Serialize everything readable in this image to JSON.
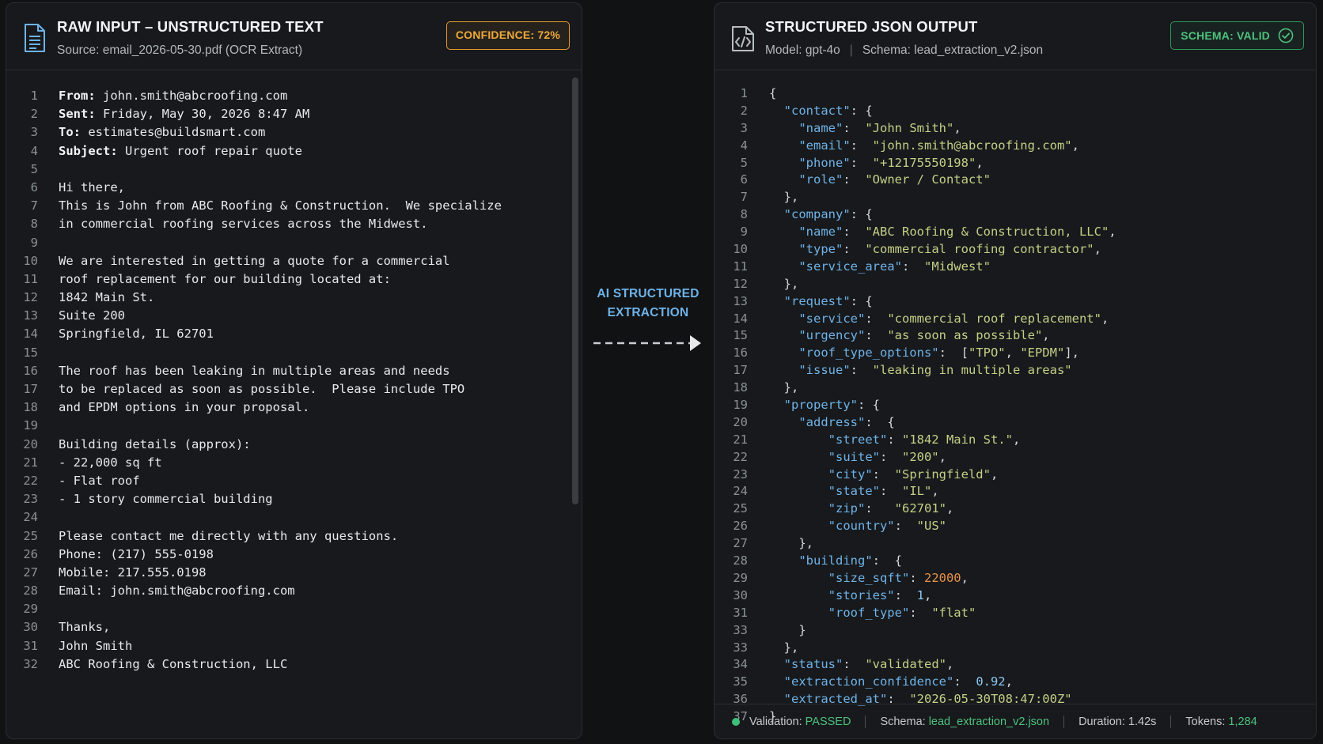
{
  "left_panel": {
    "title": "RAW INPUT – UNSTRUCTURED TEXT",
    "source": "Source: email_2026-05-30.pdf (OCR Extract)",
    "confidence_badge": "CONFIDENCE: 72%",
    "icon": "document-icon",
    "lines": [
      {
        "n": "1",
        "label": "From:",
        "text": " john.smith@abcroofing.com"
      },
      {
        "n": "2",
        "label": "Sent:",
        "text": " Friday, May 30, 2026 8:47 AM"
      },
      {
        "n": "3",
        "label": "To:",
        "text": " estimates@buildsmart.com"
      },
      {
        "n": "4",
        "label": "Subject:",
        "text": " Urgent roof repair quote"
      },
      {
        "n": "5",
        "label": "",
        "text": ""
      },
      {
        "n": "6",
        "label": "",
        "text": "Hi there,"
      },
      {
        "n": "7",
        "label": "",
        "text": "This is John from ABC Roofing & Construction.  We specialize"
      },
      {
        "n": "8",
        "label": "",
        "text": "in commercial roofing services across the Midwest."
      },
      {
        "n": "9",
        "label": "",
        "text": ""
      },
      {
        "n": "10",
        "label": "",
        "text": "We are interested in getting a quote for a commercial"
      },
      {
        "n": "11",
        "label": "",
        "text": "roof replacement for our building located at:"
      },
      {
        "n": "12",
        "label": "",
        "text": "1842 Main St."
      },
      {
        "n": "13",
        "label": "",
        "text": "Suite 200"
      },
      {
        "n": "14",
        "label": "",
        "text": "Springfield, IL 62701"
      },
      {
        "n": "15",
        "label": "",
        "text": ""
      },
      {
        "n": "16",
        "label": "",
        "text": "The roof has been leaking in multiple areas and needs"
      },
      {
        "n": "17",
        "label": "",
        "text": "to be replaced as soon as possible.  Please include TPO"
      },
      {
        "n": "18",
        "label": "",
        "text": "and EPDM options in your proposal."
      },
      {
        "n": "19",
        "label": "",
        "text": ""
      },
      {
        "n": "20",
        "label": "",
        "text": "Building details (approx):"
      },
      {
        "n": "21",
        "label": "",
        "text": "- 22,000 sq ft"
      },
      {
        "n": "22",
        "label": "",
        "text": "- Flat roof"
      },
      {
        "n": "23",
        "label": "",
        "text": "- 1 story commercial building"
      },
      {
        "n": "24",
        "label": "",
        "text": ""
      },
      {
        "n": "25",
        "label": "",
        "text": "Please contact me directly with any questions."
      },
      {
        "n": "26",
        "label": "",
        "text": "Phone: (217) 555-0198"
      },
      {
        "n": "27",
        "label": "",
        "text": "Mobile: 217.555.0198"
      },
      {
        "n": "28",
        "label": "",
        "text": "Email: john.smith@abcroofing.com"
      },
      {
        "n": "29",
        "label": "",
        "text": ""
      },
      {
        "n": "30",
        "label": "",
        "text": "Thanks,"
      },
      {
        "n": "31",
        "label": "",
        "text": "John Smith"
      },
      {
        "n": "32",
        "label": "",
        "text": "ABC Roofing & Construction, LLC"
      }
    ]
  },
  "middle": {
    "label_line1": "AI STRUCTURED",
    "label_line2": "EXTRACTION",
    "arrow_icon": "dashed-arrow-right-icon"
  },
  "right_panel": {
    "title": "STRUCTURED JSON OUTPUT",
    "model": "Model: gpt-4o",
    "schema": "Schema: lead_extraction_v2.json",
    "schema_badge": "SCHEMA: VALID",
    "icon": "code-file-icon",
    "badge_icon": "check-circle-icon",
    "lines": [
      {
        "n": "1",
        "tokens": [
          [
            "p",
            "{"
          ]
        ]
      },
      {
        "n": "2",
        "tokens": [
          [
            "p",
            "  "
          ],
          [
            "k",
            "\"contact\""
          ],
          [
            "p",
            ": {"
          ]
        ]
      },
      {
        "n": "3",
        "tokens": [
          [
            "p",
            "    "
          ],
          [
            "k",
            "\"name\""
          ],
          [
            "p",
            ":  "
          ],
          [
            "s",
            "\"John Smith\""
          ],
          [
            "p",
            ","
          ]
        ]
      },
      {
        "n": "4",
        "tokens": [
          [
            "p",
            "    "
          ],
          [
            "k",
            "\"email\""
          ],
          [
            "p",
            ":  "
          ],
          [
            "s",
            "\"john.smith@abcroofing.com\""
          ],
          [
            "p",
            ","
          ]
        ]
      },
      {
        "n": "5",
        "tokens": [
          [
            "p",
            "    "
          ],
          [
            "k",
            "\"phone\""
          ],
          [
            "p",
            ":  "
          ],
          [
            "s",
            "\"+12175550198\""
          ],
          [
            "p",
            ","
          ]
        ]
      },
      {
        "n": "6",
        "tokens": [
          [
            "p",
            "    "
          ],
          [
            "k",
            "\"role\""
          ],
          [
            "p",
            ":  "
          ],
          [
            "s",
            "\"Owner / Contact\""
          ]
        ]
      },
      {
        "n": "7",
        "tokens": [
          [
            "p",
            "  },"
          ]
        ]
      },
      {
        "n": "8",
        "tokens": [
          [
            "p",
            "  "
          ],
          [
            "k",
            "\"company\""
          ],
          [
            "p",
            ": {"
          ]
        ]
      },
      {
        "n": "9",
        "tokens": [
          [
            "p",
            "    "
          ],
          [
            "k",
            "\"name\""
          ],
          [
            "p",
            ":  "
          ],
          [
            "s",
            "\"ABC Roofing & Construction, LLC\""
          ],
          [
            "p",
            ","
          ]
        ]
      },
      {
        "n": "10",
        "tokens": [
          [
            "p",
            "    "
          ],
          [
            "k",
            "\"type\""
          ],
          [
            "p",
            ":  "
          ],
          [
            "s",
            "\"commercial roofing contractor\""
          ],
          [
            "p",
            ","
          ]
        ]
      },
      {
        "n": "11",
        "tokens": [
          [
            "p",
            "    "
          ],
          [
            "k",
            "\"service_area\""
          ],
          [
            "p",
            ":  "
          ],
          [
            "s",
            "\"Midwest\""
          ]
        ]
      },
      {
        "n": "12",
        "tokens": [
          [
            "p",
            "  },"
          ]
        ]
      },
      {
        "n": "13",
        "tokens": [
          [
            "p",
            "  "
          ],
          [
            "k",
            "\"request\""
          ],
          [
            "p",
            ": {"
          ]
        ]
      },
      {
        "n": "14",
        "tokens": [
          [
            "p",
            "    "
          ],
          [
            "k",
            "\"service\""
          ],
          [
            "p",
            ":  "
          ],
          [
            "s",
            "\"commercial roof replacement\""
          ],
          [
            "p",
            ","
          ]
        ]
      },
      {
        "n": "15",
        "tokens": [
          [
            "p",
            "    "
          ],
          [
            "k",
            "\"urgency\""
          ],
          [
            "p",
            ":  "
          ],
          [
            "s",
            "\"as soon as possible\""
          ],
          [
            "p",
            ","
          ]
        ]
      },
      {
        "n": "16",
        "tokens": [
          [
            "p",
            "    "
          ],
          [
            "k",
            "\"roof_type_options\""
          ],
          [
            "p",
            ":  ["
          ],
          [
            "s",
            "\"TPO\""
          ],
          [
            "p",
            ", "
          ],
          [
            "s",
            "\"EPDM\""
          ],
          [
            "p",
            "],"
          ]
        ]
      },
      {
        "n": "17",
        "tokens": [
          [
            "p",
            "    "
          ],
          [
            "k",
            "\"issue\""
          ],
          [
            "p",
            ":  "
          ],
          [
            "s",
            "\"leaking in multiple areas\""
          ]
        ]
      },
      {
        "n": "18",
        "tokens": [
          [
            "p",
            "  },"
          ]
        ]
      },
      {
        "n": "19",
        "tokens": [
          [
            "p",
            "  "
          ],
          [
            "k",
            "\"property\""
          ],
          [
            "p",
            ": {"
          ]
        ]
      },
      {
        "n": "20",
        "tokens": [
          [
            "p",
            "    "
          ],
          [
            "k",
            "\"address\""
          ],
          [
            "p",
            ":  {"
          ]
        ]
      },
      {
        "n": "21",
        "tokens": [
          [
            "p",
            "        "
          ],
          [
            "k",
            "\"street\""
          ],
          [
            "p",
            ": "
          ],
          [
            "s",
            "\"1842 Main St.\""
          ],
          [
            "p",
            ","
          ]
        ]
      },
      {
        "n": "22",
        "tokens": [
          [
            "p",
            "        "
          ],
          [
            "k",
            "\"suite\""
          ],
          [
            "p",
            ":  "
          ],
          [
            "s",
            "\"200\""
          ],
          [
            "p",
            ","
          ]
        ]
      },
      {
        "n": "23",
        "tokens": [
          [
            "p",
            "        "
          ],
          [
            "k",
            "\"city\""
          ],
          [
            "p",
            ":  "
          ],
          [
            "s",
            "\"Springfield\""
          ],
          [
            "p",
            ","
          ]
        ]
      },
      {
        "n": "24",
        "tokens": [
          [
            "p",
            "        "
          ],
          [
            "k",
            "\"state\""
          ],
          [
            "p",
            ":  "
          ],
          [
            "s",
            "\"IL\""
          ],
          [
            "p",
            ","
          ]
        ]
      },
      {
        "n": "25",
        "tokens": [
          [
            "p",
            "        "
          ],
          [
            "k",
            "\"zip\""
          ],
          [
            "p",
            ":   "
          ],
          [
            "s",
            "\"62701\""
          ],
          [
            "p",
            ","
          ]
        ]
      },
      {
        "n": "26",
        "tokens": [
          [
            "p",
            "        "
          ],
          [
            "k",
            "\"country\""
          ],
          [
            "p",
            ":  "
          ],
          [
            "s",
            "\"US\""
          ]
        ]
      },
      {
        "n": "27",
        "tokens": [
          [
            "p",
            "    },"
          ]
        ]
      },
      {
        "n": "28",
        "tokens": [
          [
            "p",
            "    "
          ],
          [
            "k",
            "\"building\""
          ],
          [
            "p",
            ":  {"
          ]
        ]
      },
      {
        "n": "29",
        "tokens": [
          [
            "p",
            "        "
          ],
          [
            "k",
            "\"size_sqft\""
          ],
          [
            "p",
            ": "
          ],
          [
            "n",
            "22000"
          ],
          [
            "p",
            ","
          ]
        ]
      },
      {
        "n": "30",
        "tokens": [
          [
            "p",
            "        "
          ],
          [
            "k",
            "\"stories\""
          ],
          [
            "p",
            ":  "
          ],
          [
            "nb",
            "1"
          ],
          [
            "p",
            ","
          ]
        ]
      },
      {
        "n": "31",
        "tokens": [
          [
            "p",
            "        "
          ],
          [
            "k",
            "\"roof_type\""
          ],
          [
            "p",
            ":  "
          ],
          [
            "s",
            "\"flat\""
          ]
        ]
      },
      {
        "n": "33",
        "tokens": [
          [
            "p",
            "    }"
          ]
        ]
      },
      {
        "n": "33",
        "tokens": [
          [
            "p",
            "  },"
          ]
        ]
      },
      {
        "n": "34",
        "tokens": [
          [
            "p",
            "  "
          ],
          [
            "k",
            "\"status\""
          ],
          [
            "p",
            ":  "
          ],
          [
            "s",
            "\"validated\""
          ],
          [
            "p",
            ","
          ]
        ]
      },
      {
        "n": "35",
        "tokens": [
          [
            "p",
            "  "
          ],
          [
            "k",
            "\"extraction_confidence\""
          ],
          [
            "p",
            ":  "
          ],
          [
            "nb",
            "0.92"
          ],
          [
            "p",
            ","
          ]
        ]
      },
      {
        "n": "36",
        "tokens": [
          [
            "p",
            "  "
          ],
          [
            "k",
            "\"extracted_at\""
          ],
          [
            "p",
            ":  "
          ],
          [
            "s",
            "\"2026-05-30T08:47:00Z\""
          ]
        ]
      },
      {
        "n": "37",
        "tokens": [
          [
            "p",
            "}"
          ]
        ]
      }
    ],
    "status": {
      "validation_label": "Validation:",
      "validation_value": "PASSED",
      "schema_label": "Schema:",
      "schema_value": "lead_extraction_v2.json",
      "duration": "Duration: 1.42s",
      "tokens_label": "Tokens:",
      "tokens_value": "1,284"
    }
  },
  "colors": {
    "background": "#101214",
    "panel": "#17191c",
    "accent_blue": "#6fb3e8",
    "confidence_orange": "#f0a83a",
    "valid_green": "#4ec27e",
    "json_string": "#c6cf86",
    "json_number": "#e8934a"
  }
}
